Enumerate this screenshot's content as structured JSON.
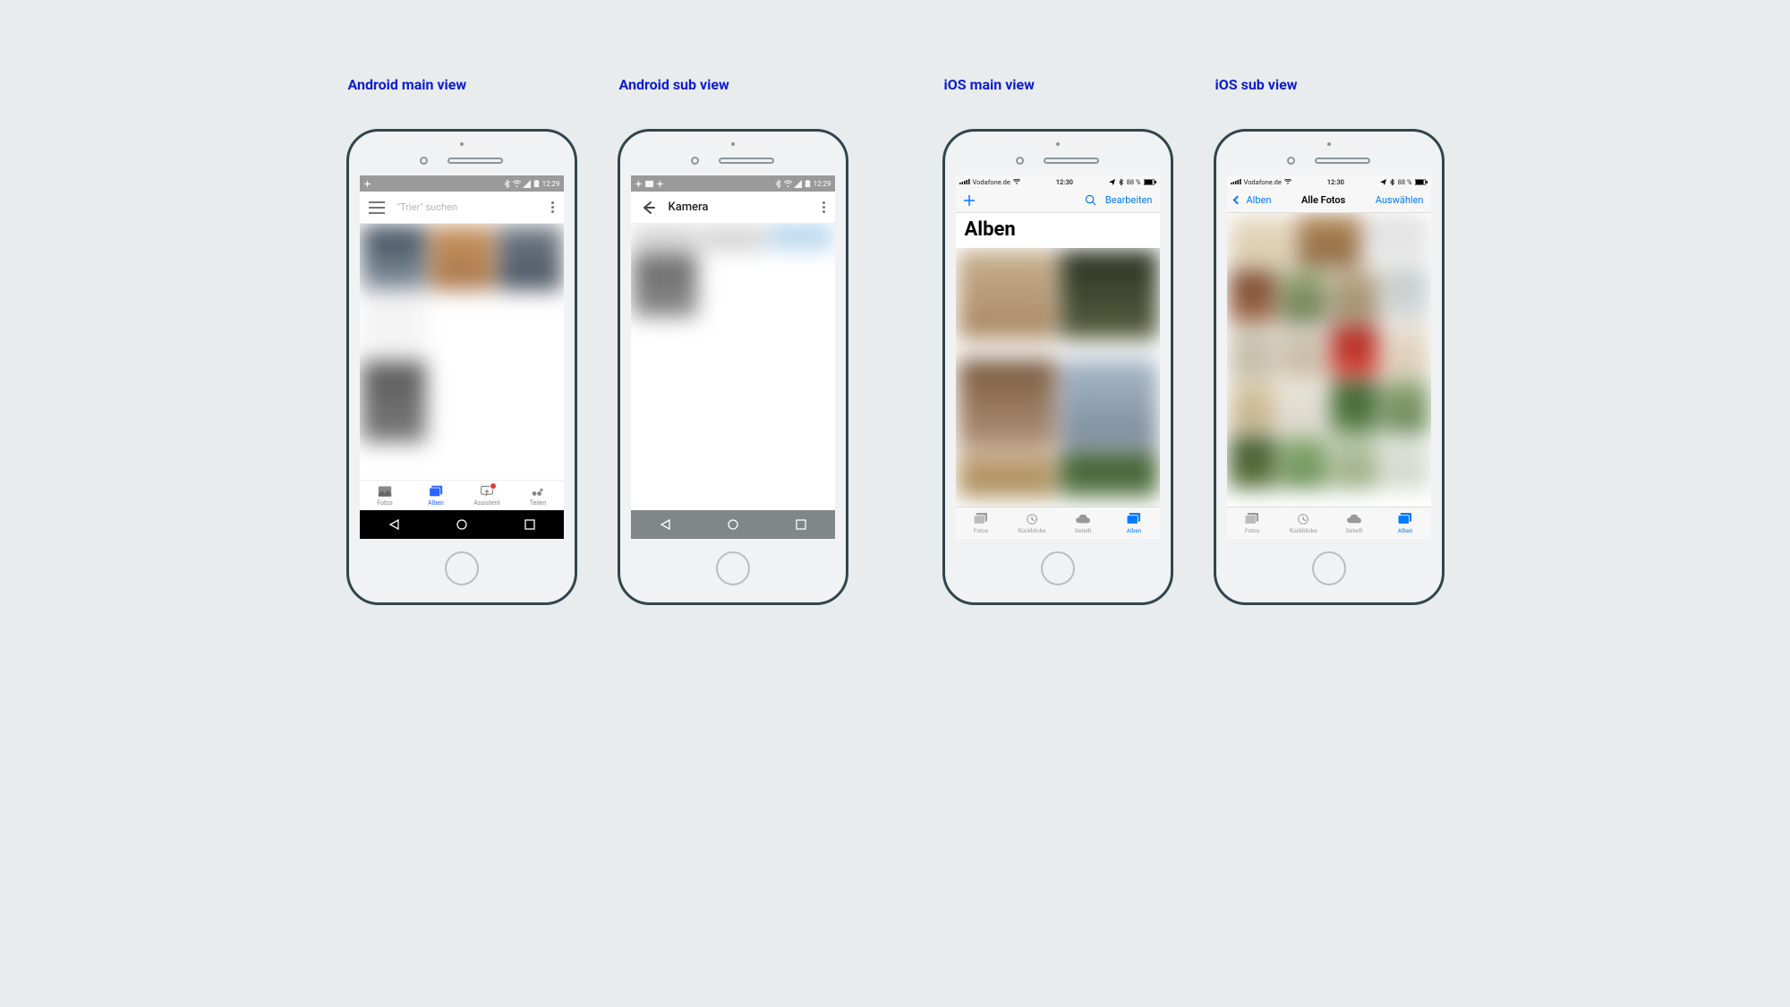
{
  "captions": {
    "android_main": "Android main view",
    "android_sub": "Android sub view",
    "ios_main": "iOS main view",
    "ios_sub": "iOS sub view"
  },
  "android": {
    "status_time": "12:29",
    "search_placeholder": "\"Trier\" suchen",
    "sub_title": "Kamera",
    "tabs": [
      {
        "label": "Fotos"
      },
      {
        "label": "Alben"
      },
      {
        "label": "Assistent"
      },
      {
        "label": "Teilen"
      }
    ]
  },
  "ios": {
    "carrier": "Vodafone.de",
    "status_time": "12:30",
    "battery": "88 %",
    "main": {
      "edit": "Bearbeiten",
      "large_title": "Alben"
    },
    "sub": {
      "back": "Alben",
      "title": "Alle Fotos",
      "select": "Auswählen"
    },
    "tabs": [
      {
        "label": "Fotos"
      },
      {
        "label": "Rückblicke"
      },
      {
        "label": "Geteilt"
      },
      {
        "label": "Alben"
      }
    ]
  }
}
